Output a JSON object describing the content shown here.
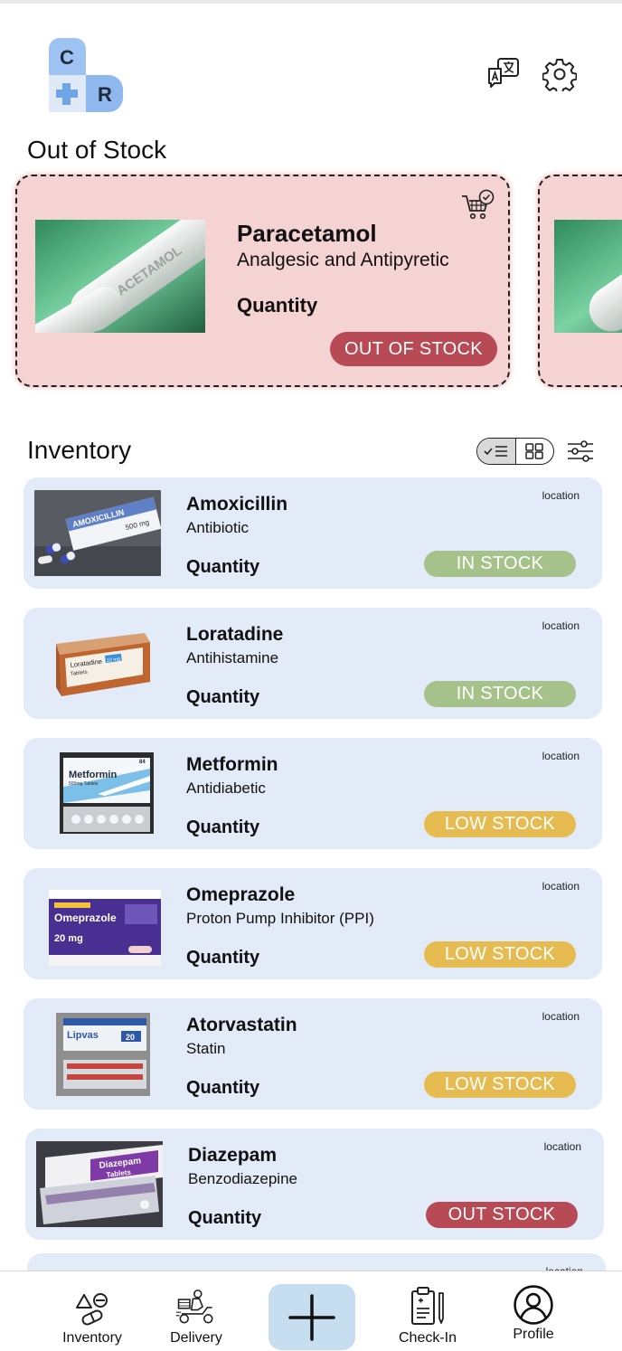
{
  "header": {
    "logo": {
      "letter_top": "C",
      "letter_bottom": "R",
      "icon": "medical-cross-icon"
    },
    "translate_icon": "translate-icon",
    "settings_icon": "gear-icon"
  },
  "out_of_stock": {
    "title": "Out of Stock",
    "cards": [
      {
        "name": "Paracetamol",
        "category": "Analgesic and Antipyretic",
        "quantity_label": "Quantity",
        "status": "OUT OF STOCK",
        "icon": "cart-check-icon"
      }
    ]
  },
  "inventory": {
    "title": "Inventory",
    "view_toggle": {
      "list_icon": "checklist-icon",
      "grid_icon": "grid-icon",
      "selected": "list"
    },
    "filter_icon": "sliders-icon",
    "items": [
      {
        "name": "Amoxicillin",
        "category": "Antibiotic",
        "quantity_label": "Quantity",
        "location": "location",
        "status": "IN STOCK",
        "status_type": "in"
      },
      {
        "name": "Loratadine",
        "category": "Antihistamine",
        "quantity_label": "Quantity",
        "location": "location",
        "status": "IN STOCK",
        "status_type": "in"
      },
      {
        "name": "Metformin",
        "category": "Antidiabetic",
        "quantity_label": "Quantity",
        "location": "location",
        "status": "LOW STOCK",
        "status_type": "low"
      },
      {
        "name": "Omeprazole",
        "category": "Proton Pump Inhibitor (PPI)",
        "quantity_label": "Quantity",
        "location": "location",
        "status": "LOW STOCK",
        "status_type": "low"
      },
      {
        "name": "Atorvastatin",
        "category": "Statin",
        "quantity_label": "Quantity",
        "location": "location",
        "status": "LOW STOCK",
        "status_type": "low"
      },
      {
        "name": "Diazepam",
        "category": "Benzodiazepine",
        "quantity_label": "Quantity",
        "location": "location",
        "status": "OUT STOCK",
        "status_type": "out"
      },
      {
        "name": "",
        "category": "",
        "quantity_label": "",
        "location": "location",
        "status": "",
        "status_type": ""
      }
    ],
    "product_images": {
      "Amoxicillin": {
        "box_text": "AMOXICILLIN",
        "dose": "500 mg"
      },
      "Loratadine": {
        "box_text": "Loratadine",
        "dose": "10 mg",
        "sub": "Tablets"
      },
      "Metformin": {
        "box_text": "Metformin",
        "dose": "500mg Tablets",
        "count": "84"
      },
      "Omeprazole": {
        "box_text": "Omeprazole",
        "dose": "20 mg"
      },
      "Atorvastatin": {
        "box_text": "Lipvas",
        "dose": "20"
      },
      "Diazepam": {
        "box_text": "Diazepam",
        "sub": "Tablets"
      },
      "Paracetamol": {
        "pill_text": "PARACETAMOL"
      }
    }
  },
  "bottom_nav": {
    "items": [
      {
        "label": "Inventory",
        "icon": "pills-icon"
      },
      {
        "label": "Delivery",
        "icon": "delivery-scooter-icon"
      },
      {
        "label": "",
        "icon": "plus-icon"
      },
      {
        "label": "Check-In",
        "icon": "clipboard-pen-icon"
      },
      {
        "label": "Profile",
        "icon": "user-circle-icon"
      }
    ]
  },
  "colors": {
    "oos_card_bg": "#f5d3d3",
    "inv_card_bg": "#e3eaf8",
    "badge_in": "#a6c28b",
    "badge_low": "#e5bb52",
    "badge_out": "#b84a55",
    "logo_blue": "#8eb8ee",
    "add_button_bg": "#c7ddf0"
  }
}
